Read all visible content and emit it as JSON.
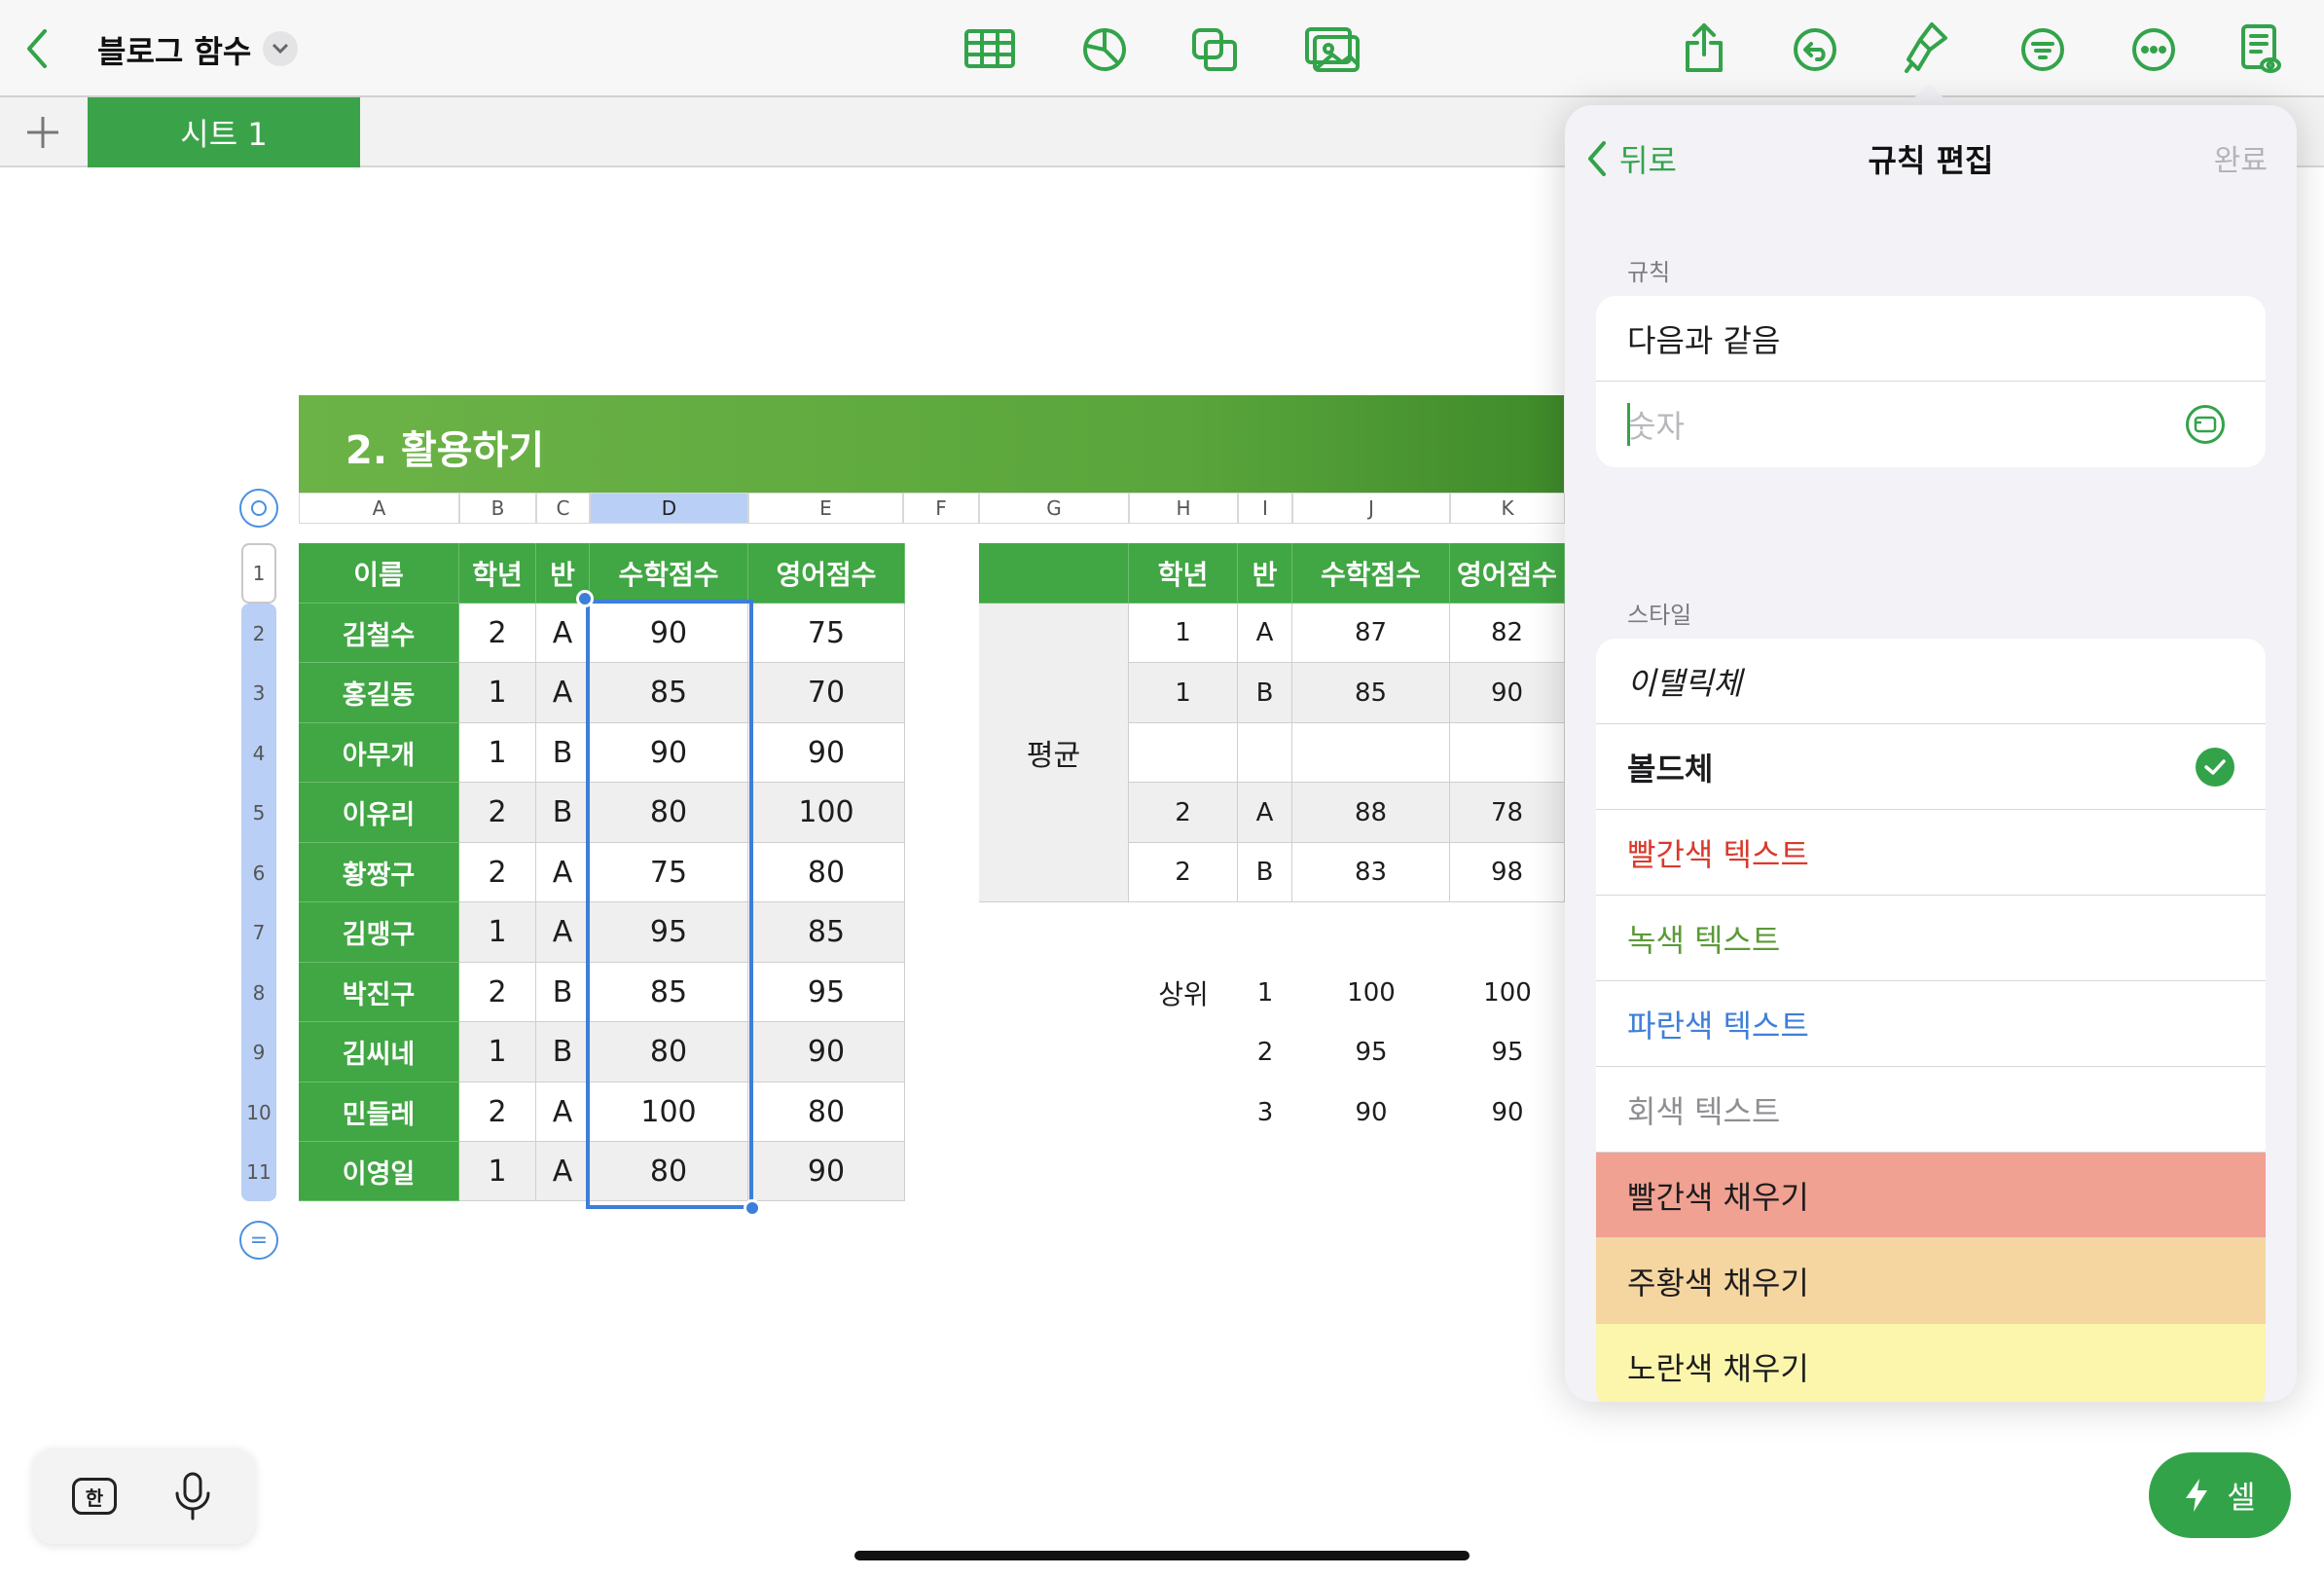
{
  "toolbar": {
    "doc_title": "블로그 함수",
    "icons": [
      "back-chevron-icon",
      "table-icon",
      "chart-icon",
      "shape-icon",
      "media-icon",
      "share-icon",
      "undo-icon",
      "format-brush-icon",
      "organize-icon",
      "more-icon",
      "reading-view-icon"
    ]
  },
  "tabs": {
    "add_label": "+",
    "sheet_name": "시트 1"
  },
  "spreadsheet": {
    "banner_title": "2. 활용하기",
    "columns": [
      "A",
      "B",
      "C",
      "D",
      "E",
      "F",
      "G",
      "H",
      "I",
      "J",
      "K"
    ],
    "row_numbers": [
      "1",
      "2",
      "3",
      "4",
      "5",
      "6",
      "7",
      "8",
      "9",
      "10",
      "11"
    ],
    "table1": {
      "headers": [
        "이름",
        "학년",
        "반",
        "수학점수",
        "영어점수"
      ],
      "rows": [
        [
          "김철수",
          "2",
          "A",
          "90",
          "75"
        ],
        [
          "홍길동",
          "1",
          "A",
          "85",
          "70"
        ],
        [
          "아무개",
          "1",
          "B",
          "90",
          "90"
        ],
        [
          "이유리",
          "2",
          "B",
          "80",
          "100"
        ],
        [
          "황짱구",
          "2",
          "A",
          "75",
          "80"
        ],
        [
          "김맹구",
          "1",
          "A",
          "95",
          "85"
        ],
        [
          "박진구",
          "2",
          "B",
          "85",
          "95"
        ],
        [
          "김씨네",
          "1",
          "B",
          "80",
          "90"
        ],
        [
          "민들레",
          "2",
          "A",
          "100",
          "80"
        ],
        [
          "이영일",
          "1",
          "A",
          "80",
          "90"
        ]
      ]
    },
    "table2": {
      "headers": [
        "학년",
        "반",
        "수학점수",
        "영어점수"
      ],
      "avg_label": "평균",
      "rows": [
        [
          "1",
          "A",
          "87",
          "82"
        ],
        [
          "1",
          "B",
          "85",
          "90"
        ],
        [
          "",
          "",
          "",
          ""
        ],
        [
          "2",
          "A",
          "88",
          "78"
        ],
        [
          "2",
          "B",
          "83",
          "98"
        ]
      ]
    },
    "top": {
      "label": "상위",
      "rows": [
        [
          "1",
          "100",
          "100"
        ],
        [
          "2",
          "95",
          "95"
        ],
        [
          "3",
          "90",
          "90"
        ]
      ]
    }
  },
  "panel": {
    "back_label": "뒤로",
    "title": "규칙 편집",
    "done_label": "완료",
    "rule_section": "규칙",
    "rule_name": "다음과 같음",
    "rule_placeholder": "숫자",
    "style_section": "스타일",
    "styles": [
      {
        "label": "이탤릭체",
        "color": "#1c1c1e",
        "bg": "#ffffff"
      },
      {
        "label": "볼드체",
        "color": "#1c1c1e",
        "bg": "#ffffff",
        "checked": true
      },
      {
        "label": "빨간색 텍스트",
        "color": "#d93a2b",
        "bg": "#ffffff"
      },
      {
        "label": "녹색 텍스트",
        "color": "#5b9a37",
        "bg": "#ffffff"
      },
      {
        "label": "파란색 텍스트",
        "color": "#3f7fd9",
        "bg": "#ffffff"
      },
      {
        "label": "회색 텍스트",
        "color": "#8e8e93",
        "bg": "#ffffff"
      },
      {
        "label": "빨간색 채우기",
        "color": "#1c1c1e",
        "bg": "#f0a191"
      },
      {
        "label": "주황색 채우기",
        "color": "#1c1c1e",
        "bg": "#f6d6a0"
      },
      {
        "label": "노란색 채우기",
        "color": "#1c1c1e",
        "bg": "#fbf6ac"
      }
    ]
  },
  "bottom": {
    "hangul_key": "한",
    "cell_button": "셀"
  },
  "colors": {
    "accent": "#33a34a",
    "header_green": "#41a644",
    "selection_blue": "#3c7fd9"
  }
}
